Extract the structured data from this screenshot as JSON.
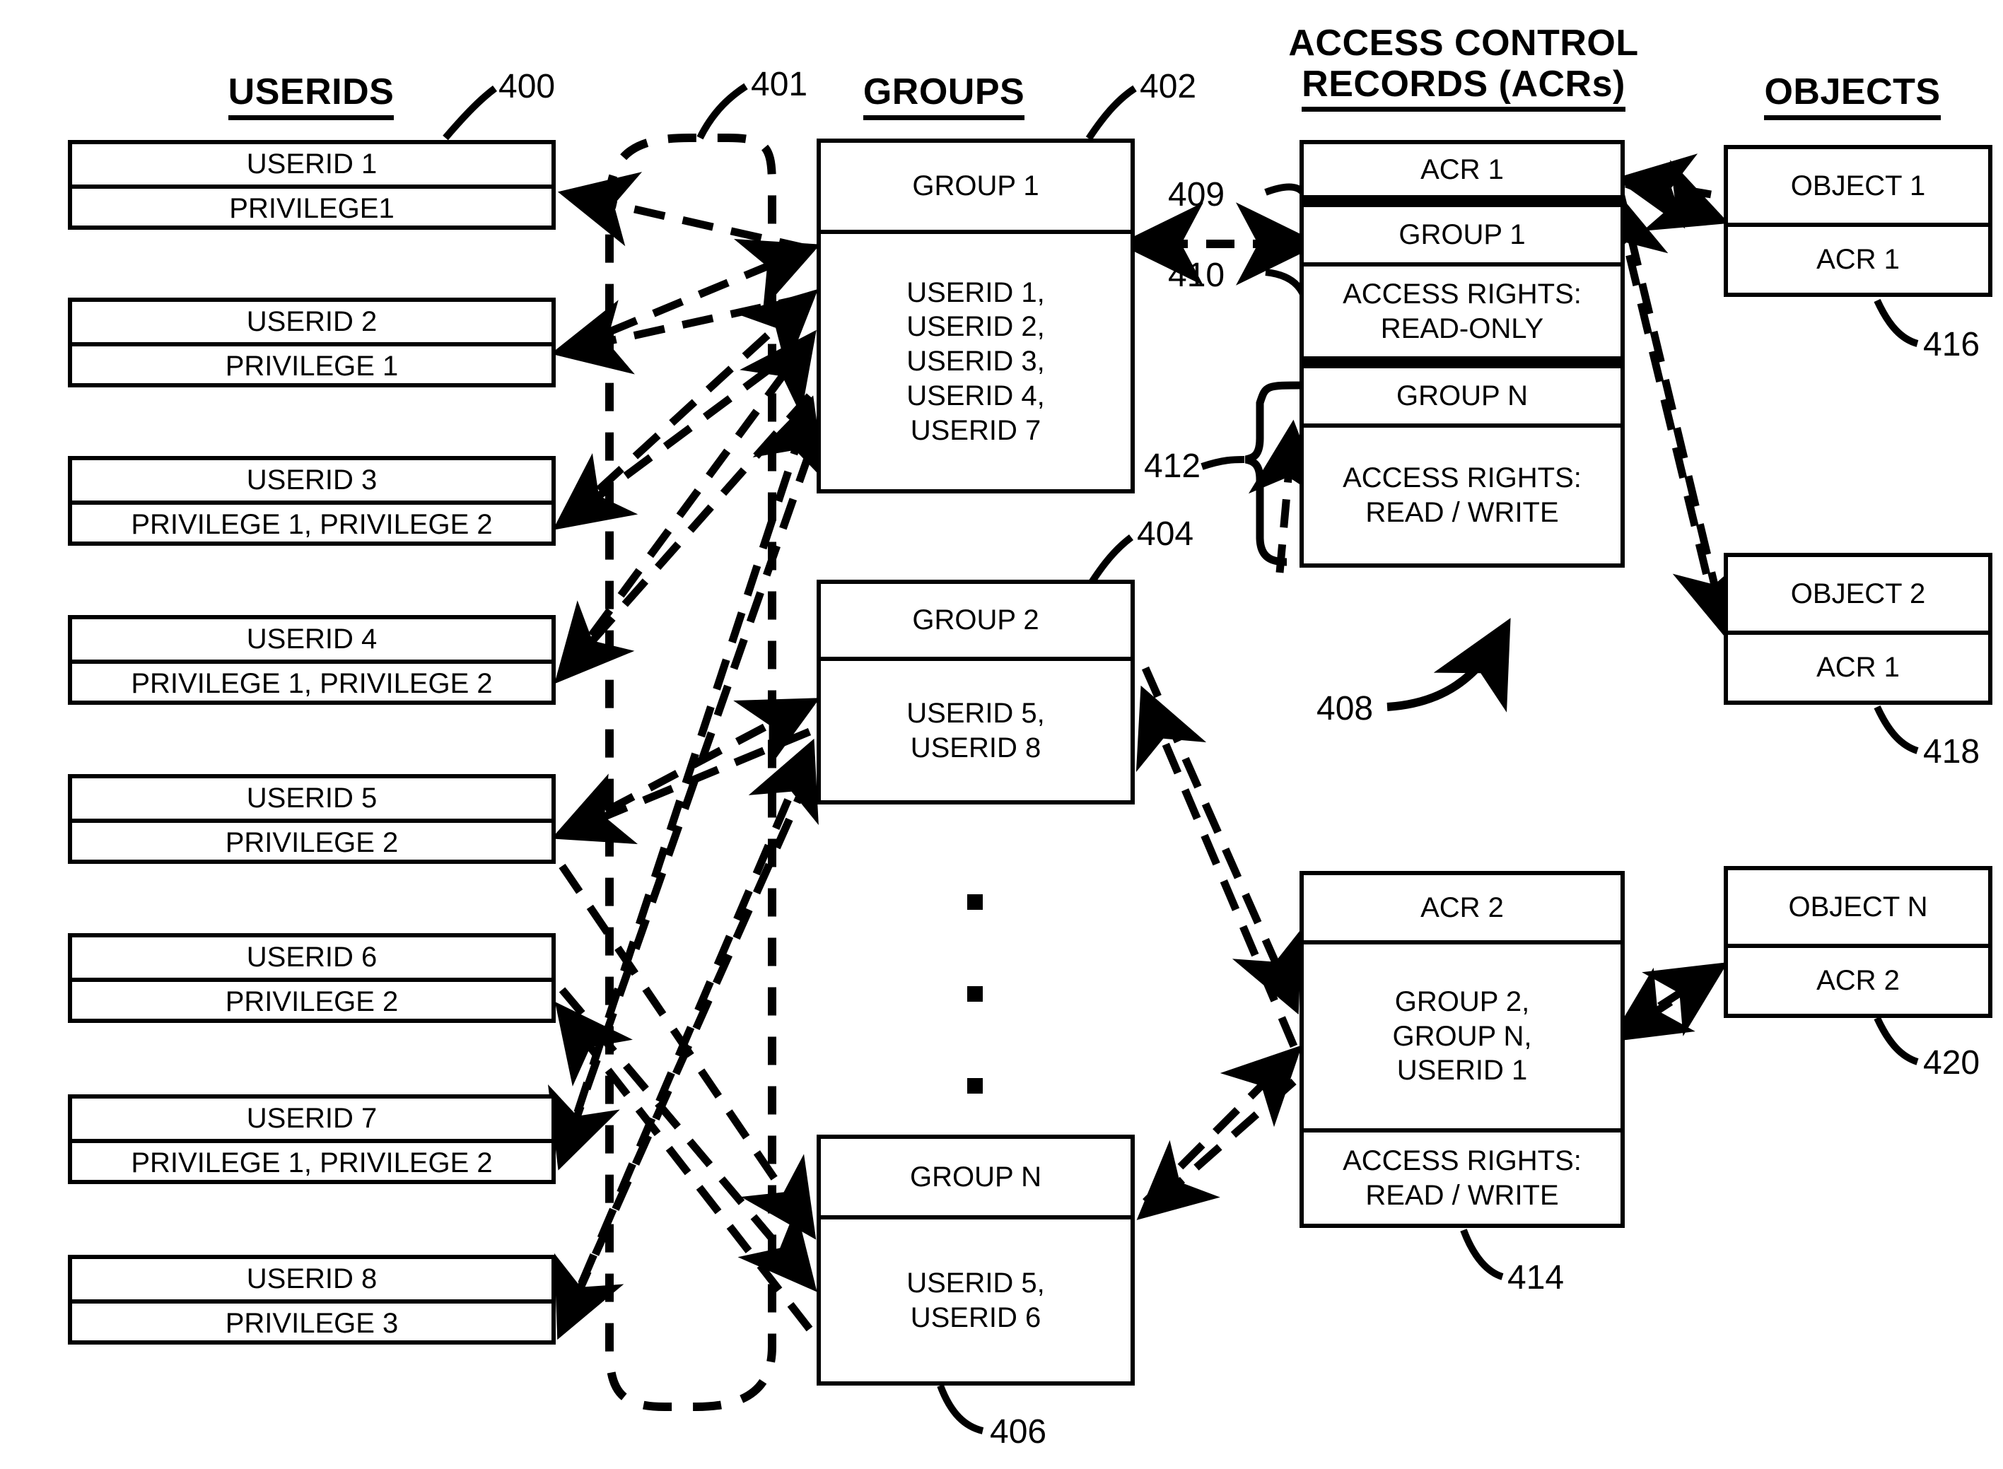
{
  "headings": {
    "userids": "USERIDS",
    "groups": "GROUPS",
    "acr_line1": "ACCESS CONTROL",
    "acr_line2": "RECORDS (ACRs)",
    "objects": "OBJECTS"
  },
  "userids": [
    {
      "id": "USERID 1",
      "privileges": "PRIVILEGE1"
    },
    {
      "id": "USERID 2",
      "privileges": "PRIVILEGE 1"
    },
    {
      "id": "USERID 3",
      "privileges": "PRIVILEGE 1, PRIVILEGE 2"
    },
    {
      "id": "USERID 4",
      "privileges": "PRIVILEGE 1, PRIVILEGE 2"
    },
    {
      "id": "USERID 5",
      "privileges": "PRIVILEGE 2"
    },
    {
      "id": "USERID 6",
      "privileges": "PRIVILEGE 2"
    },
    {
      "id": "USERID 7",
      "privileges": "PRIVILEGE 1, PRIVILEGE 2"
    },
    {
      "id": "USERID 8",
      "privileges": "PRIVILEGE 3"
    }
  ],
  "groups": [
    {
      "name": "GROUP 1",
      "members": "USERID 1,\nUSERID 2,\nUSERID 3,\nUSERID 4,\nUSERID 7"
    },
    {
      "name": "GROUP 2",
      "members": "USERID 5,\nUSERID 8"
    },
    {
      "name": "GROUP N",
      "members": "USERID 5,\nUSERID 6"
    }
  ],
  "acrs": [
    {
      "title": "ACR 1",
      "entries": [
        {
          "subject": "GROUP 1",
          "rights": "ACCESS RIGHTS:\nREAD-ONLY"
        },
        {
          "subject": "GROUP N",
          "rights": "ACCESS RIGHTS:\nREAD / WRITE"
        }
      ]
    },
    {
      "title": "ACR 2",
      "subjects": "GROUP 2,\nGROUP N,\nUSERID 1",
      "rights": "ACCESS RIGHTS:\nREAD / WRITE"
    }
  ],
  "objects": [
    {
      "name": "OBJECT 1",
      "acr": "ACR 1"
    },
    {
      "name": "OBJECT 2",
      "acr": "ACR 1"
    },
    {
      "name": "OBJECT  N",
      "acr": "ACR 2"
    }
  ],
  "reference_numerals": {
    "n400": "400",
    "n401": "401",
    "n402": "402",
    "n404": "404",
    "n406": "406",
    "n408": "408",
    "n409": "409",
    "n410": "410",
    "n412": "412",
    "n414": "414",
    "n416": "416",
    "n418": "418",
    "n420": "420"
  },
  "colors": {
    "ink": "#000000",
    "paper": "#ffffff"
  }
}
